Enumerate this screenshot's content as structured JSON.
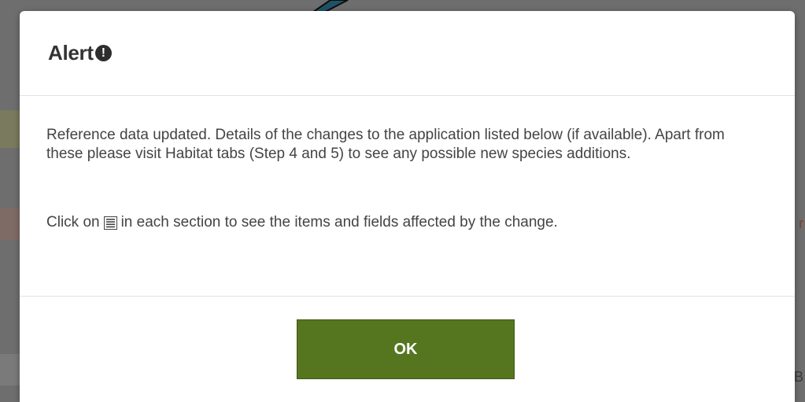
{
  "dialog": {
    "title": "Alert",
    "title_icon": "exclamation-circle-icon",
    "message_line1": "Reference data updated. Details of the changes to the application listed below (if available). Apart from these please visit Habitat tabs (Step 4 and 5) to see any possible new species additions.",
    "message_line2_before": "Click on",
    "message_line2_icon": "list-icon",
    "message_line2_after": "in each section to see the items and fields affected by the change.",
    "ok_label": "OK"
  },
  "background": {
    "edge_text_1": "r",
    "edge_text_2": "B"
  },
  "colors": {
    "ok_button": "#55761f",
    "callout_arrow": "#1f5266"
  }
}
